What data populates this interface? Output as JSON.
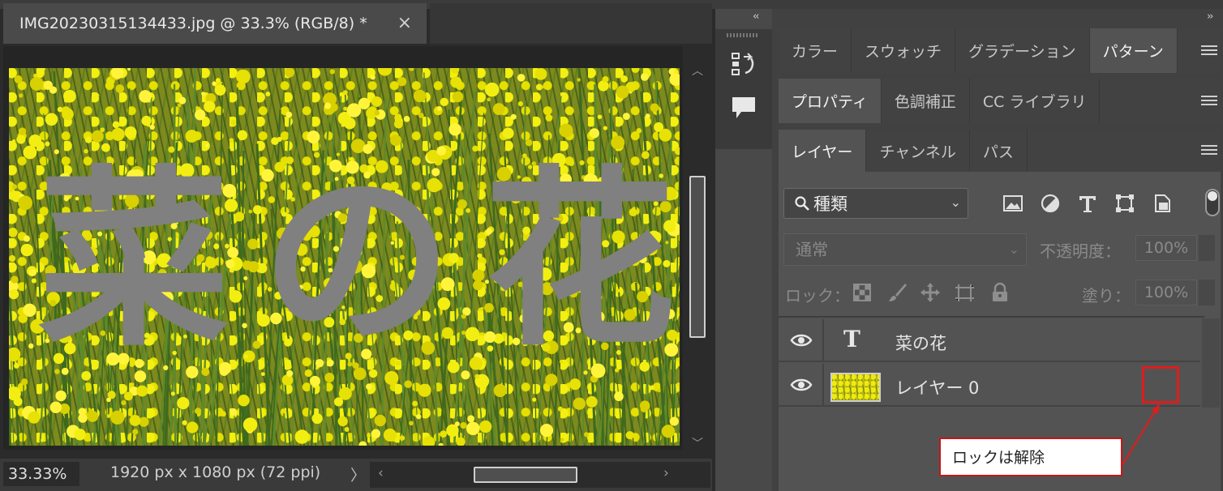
{
  "document": {
    "tab_title": "IMG20230315134433.jpg @ 33.3% (RGB/8) *",
    "close_glyph": "×",
    "canvas_text": [
      "菜",
      "の",
      "花"
    ],
    "canvas_text_color": "#808080",
    "zoom": "33.33%",
    "info": "1920 px x 1080 px (72 ppi)",
    "status_chevron": "〉"
  },
  "panel_collapse": {
    "left": "‹‹",
    "right": "››"
  },
  "panels": {
    "row1_tabs": [
      "カラー",
      "スウォッチ",
      "グラデーション",
      "パターン"
    ],
    "row1_active": 3,
    "row2_tabs": [
      "プロパティ",
      "色調補正",
      "CC ライブラリ"
    ],
    "row2_active": 0,
    "row3_tabs": [
      "レイヤー",
      "チャンネル",
      "パス"
    ],
    "row3_active": 0
  },
  "layers": {
    "filter_label": "種類",
    "blend_mode": "通常",
    "opacity_label": "不透明度：",
    "opacity_value": "100%",
    "lock_label": "ロック：",
    "fill_label": "塗り：",
    "fill_value": "100%",
    "items": [
      {
        "name": "菜の花",
        "type": "text",
        "type_glyph": "T"
      },
      {
        "name": "レイヤー 0",
        "type": "raster"
      }
    ]
  },
  "annotation": {
    "callout_text": "ロックは解除",
    "color": "#e01c1c"
  },
  "colors": {
    "panel_bg": "#535353",
    "dark_bg": "#2b2b2b",
    "flower_yellow": "#f0ea10"
  }
}
